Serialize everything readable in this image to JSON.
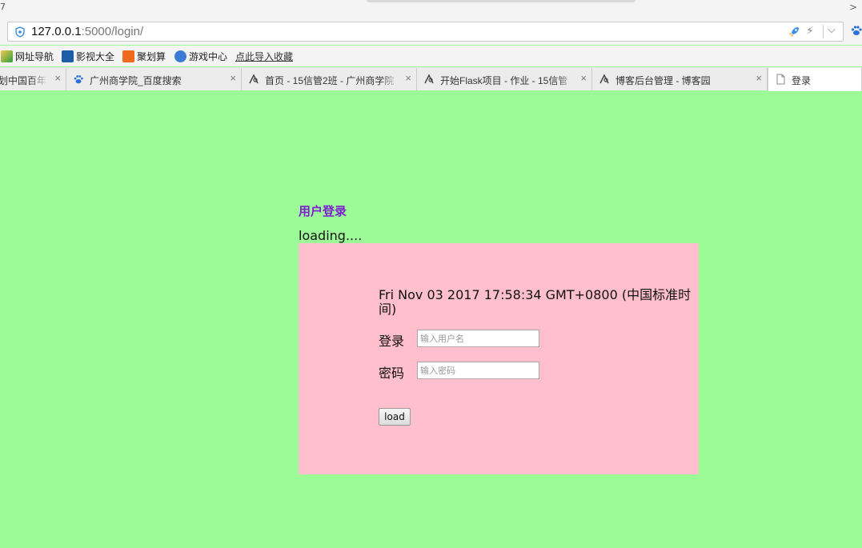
{
  "browser": {
    "top_left_glyph": "7",
    "top_right_glyph": ">",
    "address": {
      "host": "127.0.0.1",
      "path": ":5000/login/"
    },
    "bookmarks": [
      {
        "label": "网址导航",
        "icon": "home-2345-icon",
        "color": "#2e9e3e"
      },
      {
        "label": "影视大全",
        "icon": "film-icon",
        "color": "#1e5ea8"
      },
      {
        "label": "聚划算",
        "icon": "juhuasuan-icon",
        "color": "#f06a1e"
      },
      {
        "label": "游戏中心",
        "icon": "game-icon",
        "color": "#3a7bd5"
      },
      {
        "label": "点此导入收藏",
        "icon": "",
        "color": ""
      }
    ],
    "tabs": [
      {
        "title": "划中国百年",
        "icon": ""
      },
      {
        "title": "广州商学院_百度搜索",
        "icon": "baidu-paw-icon"
      },
      {
        "title": "首页 - 15信管2班 - 广州商学院",
        "icon": "cnblogs-icon"
      },
      {
        "title": "开始Flask项目 - 作业 - 15信管",
        "icon": "cnblogs-icon"
      },
      {
        "title": "博客后台管理 - 博客园",
        "icon": "cnblogs-icon"
      },
      {
        "title": "登录",
        "icon": "page-icon"
      }
    ]
  },
  "page": {
    "heading": "用户登录",
    "loading": "loading....",
    "datetime": "Fri Nov 03 2017 17:58:34 GMT+0800 (中国标准时间)",
    "username_label": "登录",
    "username_placeholder": "输入用户名",
    "password_label": "密码",
    "password_placeholder": "输入密码",
    "submit_label": "load"
  },
  "colors": {
    "page_bg": "#9dfb97",
    "panel_bg": "#ffbfcc",
    "heading": "#7b1fd1"
  }
}
